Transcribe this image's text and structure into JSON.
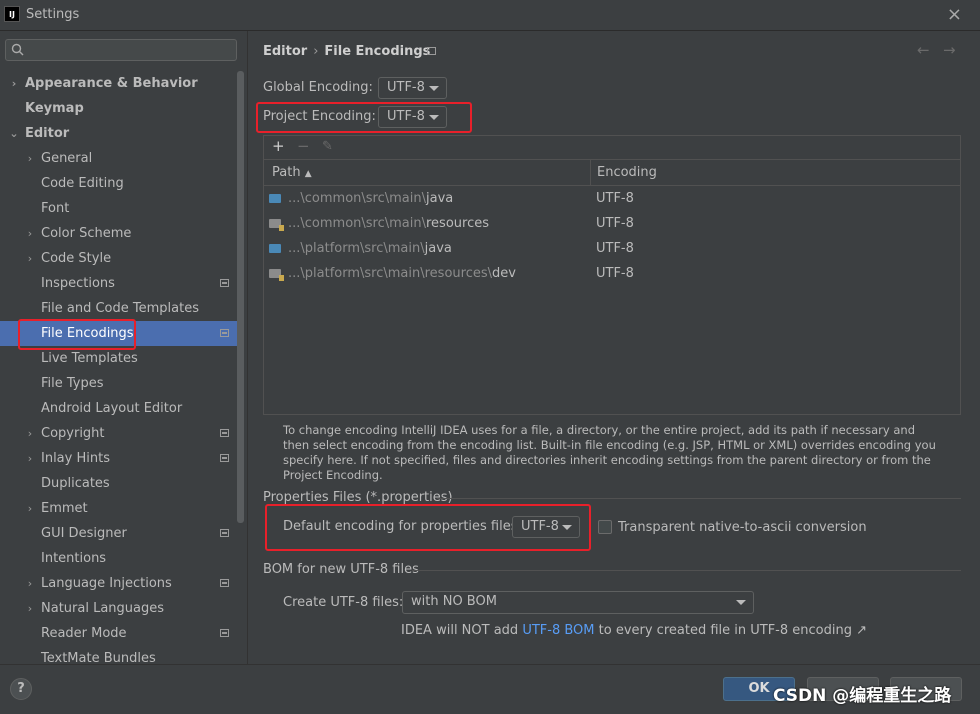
{
  "window": {
    "title": "Settings",
    "app_icon": "IJ",
    "close_icon": "×"
  },
  "search": {
    "placeholder": "",
    "icon": "search-icon"
  },
  "sidebar": {
    "items": [
      {
        "label": "Appearance & Behavior",
        "bold": true,
        "arrow": "›",
        "marker": false
      },
      {
        "label": "Keymap",
        "bold": true,
        "arrow": "",
        "marker": false
      },
      {
        "label": "Editor",
        "bold": true,
        "arrow": "⌄",
        "marker": false
      },
      {
        "label": "General",
        "arrow": "›",
        "marker": false
      },
      {
        "label": "Code Editing",
        "arrow": "",
        "marker": false
      },
      {
        "label": "Font",
        "arrow": "",
        "marker": false
      },
      {
        "label": "Color Scheme",
        "arrow": "›",
        "marker": false
      },
      {
        "label": "Code Style",
        "arrow": "›",
        "marker": false
      },
      {
        "label": "Inspections",
        "arrow": "",
        "marker": true
      },
      {
        "label": "File and Code Templates",
        "arrow": "",
        "marker": false
      },
      {
        "label": "File Encodings",
        "arrow": "",
        "marker": true,
        "selected": true
      },
      {
        "label": "Live Templates",
        "arrow": "",
        "marker": false
      },
      {
        "label": "File Types",
        "arrow": "",
        "marker": false
      },
      {
        "label": "Android Layout Editor",
        "arrow": "",
        "marker": false
      },
      {
        "label": "Copyright",
        "arrow": "›",
        "marker": true
      },
      {
        "label": "Inlay Hints",
        "arrow": "›",
        "marker": true
      },
      {
        "label": "Duplicates",
        "arrow": "",
        "marker": false
      },
      {
        "label": "Emmet",
        "arrow": "›",
        "marker": false
      },
      {
        "label": "GUI Designer",
        "arrow": "",
        "marker": true
      },
      {
        "label": "Intentions",
        "arrow": "",
        "marker": false
      },
      {
        "label": "Language Injections",
        "arrow": "›",
        "marker": true
      },
      {
        "label": "Natural Languages",
        "arrow": "›",
        "marker": false
      },
      {
        "label": "Reader Mode",
        "arrow": "",
        "marker": true
      },
      {
        "label": "TextMate Bundles",
        "arrow": "",
        "marker": false
      }
    ]
  },
  "breadcrumb": {
    "parent": "Editor",
    "separator": "›",
    "current": "File Encodings",
    "back": "←",
    "forward": "→"
  },
  "global_encoding": {
    "label": "Global Encoding:",
    "value": "UTF-8"
  },
  "project_encoding": {
    "label": "Project Encoding:",
    "value": "UTF-8"
  },
  "toolbar": {
    "add": "+",
    "remove": "−",
    "edit": "✎"
  },
  "table": {
    "headers": {
      "path": "Path",
      "sort_indicator": "▲",
      "encoding": "Encoding"
    },
    "rows": [
      {
        "prefix": "...\\common\\src\\main\\",
        "name": "java",
        "encoding": "UTF-8",
        "kind": "src"
      },
      {
        "prefix": "...\\common\\src\\main\\",
        "name": "resources",
        "encoding": "UTF-8",
        "kind": "res"
      },
      {
        "prefix": "...\\platform\\src\\main\\",
        "name": "java",
        "encoding": "UTF-8",
        "kind": "src"
      },
      {
        "prefix": "...\\platform\\src\\main\\resources\\",
        "name": "dev",
        "encoding": "UTF-8",
        "kind": "res"
      }
    ]
  },
  "description": "To change encoding IntelliJ IDEA uses for a file, a directory, or the entire project, add its path if necessary and then select encoding from the encoding list. Built-in file encoding (e.g. JSP, HTML or XML) overrides encoding you specify here. If not specified, files and directories inherit encoding settings from the parent directory or from the Project Encoding.",
  "properties": {
    "title": "Properties Files (*.properties)",
    "default_label": "Default encoding for properties files:",
    "default_value": "UTF-8",
    "transparent_label": "Transparent native-to-ascii conversion",
    "transparent_checked": false
  },
  "bom": {
    "title": "BOM for new UTF-8 files",
    "create_label": "Create UTF-8 files:",
    "create_value": "with NO BOM",
    "note_prefix": "IDEA will NOT add ",
    "note_link": "UTF-8 BOM",
    "note_suffix": " to every created file in UTF-8 encoding ↗"
  },
  "footer": {
    "help": "?",
    "ok": "OK",
    "watermark": "CSDN @编程重生之路"
  },
  "colors": {
    "selection": "#4b6eaf",
    "highlight_box": "#e8202a",
    "link": "#589df6",
    "ok_button": "#365880"
  }
}
